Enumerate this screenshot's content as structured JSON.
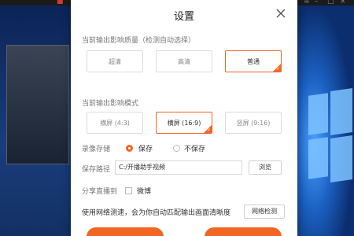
{
  "dialog": {
    "title": "设置",
    "quality": {
      "label": "当前输出影响质量（检测自动选择）",
      "options": [
        {
          "label": "超清",
          "selected": false
        },
        {
          "label": "高清",
          "selected": false
        },
        {
          "label": "普通",
          "selected": true
        }
      ]
    },
    "mode": {
      "label": "当前输出影响模式",
      "options": [
        {
          "label": "横屏 (4:3)",
          "selected": false
        },
        {
          "label": "横屏 (16:9)",
          "selected": true
        },
        {
          "label": "竖屏 (9:16)",
          "selected": false
        }
      ]
    },
    "recording": {
      "label": "录像存储",
      "save": "保存",
      "nosave": "不保存",
      "selected": "save"
    },
    "path": {
      "label": "保存路径",
      "value": "C:/开播助手视频",
      "browse": "浏览"
    },
    "share": {
      "label": "分享直播到",
      "weibo": "微博",
      "checked": false
    },
    "network": {
      "note": "使用网络测速，会为你自动匹配输出画面清晰度",
      "button": "网络检测"
    },
    "accent_color": "#f26522"
  },
  "icons": {
    "close": "close-icon",
    "corner": "check-corner-icon"
  }
}
